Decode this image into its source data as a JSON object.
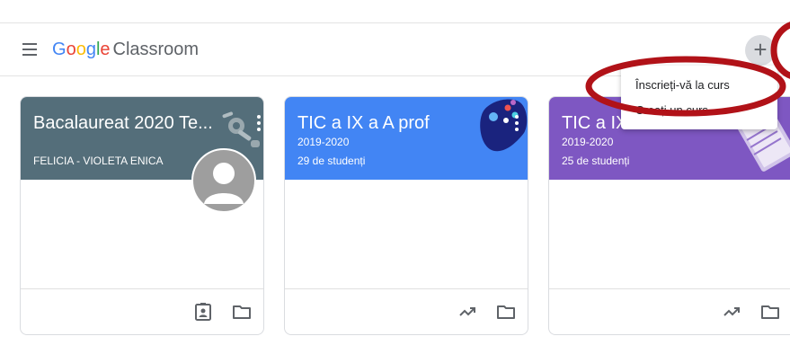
{
  "app": {
    "logo_google": [
      "G",
      "o",
      "o",
      "g",
      "l",
      "e"
    ],
    "logo_google_colors": [
      "#4285F4",
      "#EA4335",
      "#FBBC05",
      "#4285F4",
      "#34A853",
      "#EA4335"
    ],
    "logo_product": "Classroom",
    "add_button_label": "+"
  },
  "dropdown": {
    "items": [
      {
        "label": "Înscrieți-vă la curs"
      },
      {
        "label": "Creați un curs"
      }
    ]
  },
  "cards": [
    {
      "title": "Bacalaureat 2020 Te...",
      "subtitle": "FELICIA - VIOLETA ENICA",
      "header_color": "#546e7a",
      "footer_icons": [
        "assignment-ind-icon",
        "folder-icon"
      ]
    },
    {
      "title": "TIC a IX a A prof",
      "year": "2019-2020",
      "students": "29 de studenți",
      "header_color": "#4285f4",
      "footer_icons": [
        "trending-icon",
        "folder-icon"
      ]
    },
    {
      "title": "TIC a IX",
      "year": "2019-2020",
      "students": "25 de studenți",
      "header_color": "#7e57c2",
      "footer_icons": [
        "trending-icon",
        "folder-icon"
      ]
    }
  ],
  "annotation_color": "#b11218"
}
